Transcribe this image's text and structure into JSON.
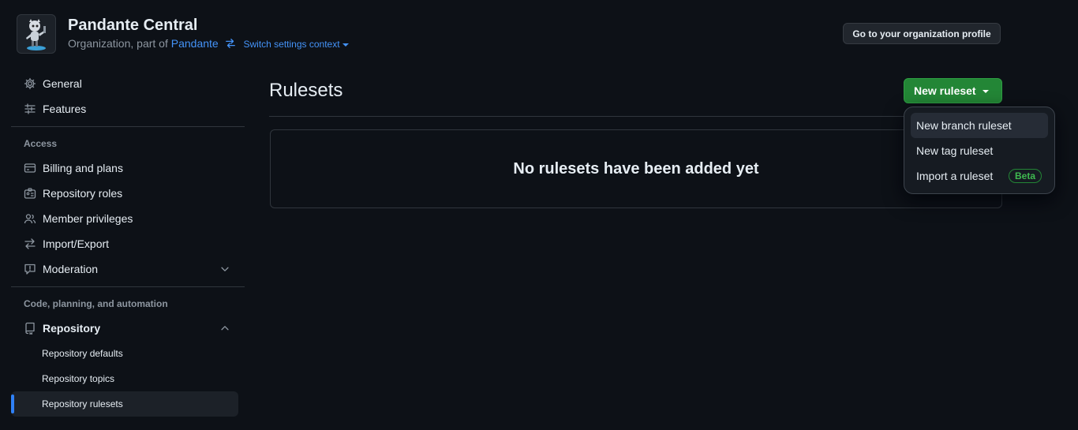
{
  "org": {
    "name": "Pandante Central",
    "subtitle_prefix": "Organization, part of",
    "parent_link": "Pandante",
    "switch_context": "Switch settings context",
    "profile_button": "Go to your organization profile"
  },
  "sidebar": {
    "top_items": [
      {
        "label": "General",
        "icon": "gear-icon"
      },
      {
        "label": "Features",
        "icon": "sliders-icon"
      }
    ],
    "sections": [
      {
        "heading": "Access",
        "items": [
          {
            "label": "Billing and plans",
            "icon": "credit-card-icon"
          },
          {
            "label": "Repository roles",
            "icon": "id-badge-icon"
          },
          {
            "label": "Member privileges",
            "icon": "people-icon"
          },
          {
            "label": "Import/Export",
            "icon": "arrow-switch-icon"
          },
          {
            "label": "Moderation",
            "icon": "report-icon"
          }
        ]
      },
      {
        "heading": "Code, planning, and automation",
        "items": [
          {
            "label": "Repository",
            "icon": "repo-icon"
          }
        ],
        "subitems": [
          {
            "label": "Repository defaults"
          },
          {
            "label": "Repository topics"
          },
          {
            "label": "Repository rulesets",
            "active": true
          }
        ]
      }
    ]
  },
  "main": {
    "title": "Rulesets",
    "empty_message": "No rulesets have been added yet",
    "new_button": "New ruleset"
  },
  "dropdown": {
    "items": [
      {
        "label": "New branch ruleset"
      },
      {
        "label": "New tag ruleset"
      },
      {
        "label": "Import a ruleset",
        "badge": "Beta"
      }
    ]
  },
  "colors": {
    "background": "#0d1117",
    "accent_link": "#4493f8",
    "primary_button": "#238636",
    "active_indicator": "#2f81f7"
  }
}
